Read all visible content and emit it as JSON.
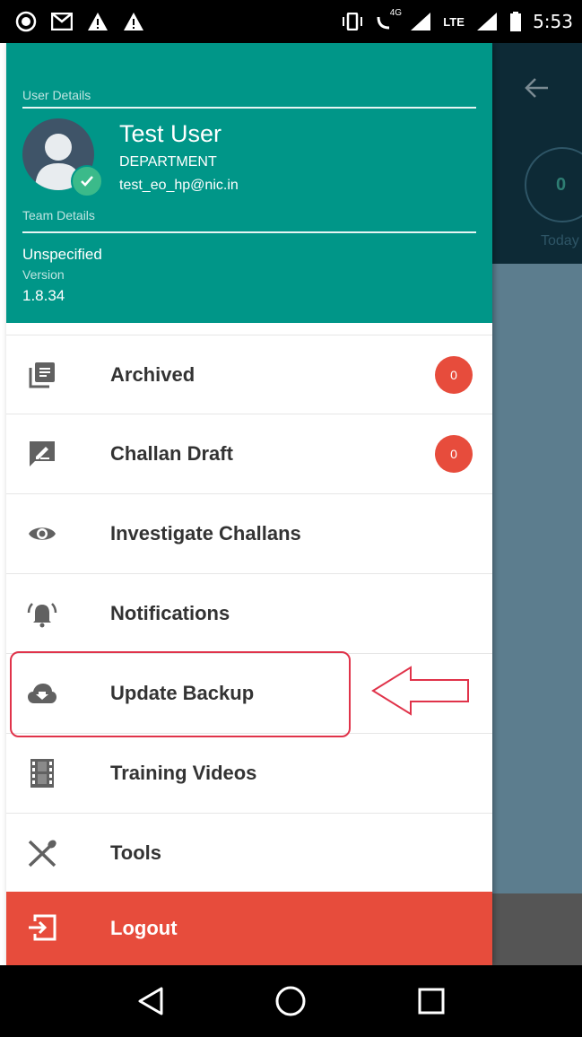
{
  "status_bar": {
    "time": "5:53",
    "left_icons": [
      "whatsapp-icon",
      "gmail-icon",
      "warning-icon",
      "warning-icon"
    ],
    "right_icons": [
      "vibrate-icon",
      "volte-4g-icon",
      "signal-icon",
      "lte-signal-icon",
      "battery-icon"
    ],
    "volte_label": "4G",
    "lte_label": "LTE"
  },
  "background_app": {
    "count": "0",
    "today_label": "Today"
  },
  "drawer": {
    "user_details_label": "User Details",
    "user_name": "Test User",
    "department": "DEPARTMENT",
    "email": "test_eo_hp@nic.in",
    "team_details_label": "Team Details",
    "team": "Unspecified",
    "version_label": "Version",
    "version": "1.8.34"
  },
  "menu": {
    "items": [
      {
        "label": "Archived",
        "icon": "archive-icon",
        "badge": "0"
      },
      {
        "label": "Challan Draft",
        "icon": "edit-icon",
        "badge": "0"
      },
      {
        "label": "Investigate Challans",
        "icon": "eye-icon"
      },
      {
        "label": "Notifications",
        "icon": "bell-icon"
      },
      {
        "label": "Update Backup",
        "icon": "cloud-download-icon"
      },
      {
        "label": "Training Videos",
        "icon": "film-icon"
      },
      {
        "label": "Tools",
        "icon": "tools-icon"
      }
    ],
    "logout_label": "Logout"
  },
  "colors": {
    "header": "#009688",
    "badge": "#e74c3c",
    "logout": "#e74c3c",
    "highlight": "#e0334a"
  }
}
